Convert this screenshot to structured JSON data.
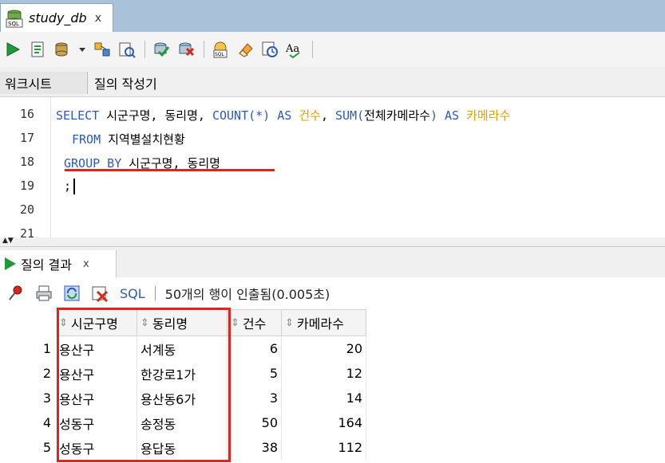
{
  "document_tab": {
    "title": "study_db",
    "close": "x"
  },
  "subtabs": {
    "worksheet": "워크시트",
    "query_builder": "질의 작성기"
  },
  "editor": {
    "line_numbers": [
      "16",
      "17",
      "18",
      "19",
      "20",
      "21"
    ],
    "line16": {
      "select": "SELECT",
      "col1": " 시군구명, 동리명, ",
      "count": "COUNT(*)",
      "as1": " AS ",
      "alias1": "건수",
      "comma": ", ",
      "sum": "SUM(",
      "sumarg": "전체카메라수",
      "sumclose": ")",
      "as2": " AS ",
      "alias2": "카메라수"
    },
    "line17": {
      "from": "FROM",
      "table": " 지역별설치현황"
    },
    "line18": {
      "groupby": "GROUP BY",
      "cols": " 시군구명, 동리명"
    },
    "line19": {
      "semicolon": ";"
    }
  },
  "results_tab": {
    "label": "질의 결과",
    "close": "x"
  },
  "results_toolbar": {
    "sql": "SQL",
    "status": "50개의 행이 인출됨(0.005초)"
  },
  "grid": {
    "columns": [
      "시군구명",
      "동리명",
      "건수",
      "카메라수"
    ],
    "rows": [
      {
        "num": "1",
        "sigungu": "용산구",
        "dongri": "서계동",
        "count": "6",
        "cameras": "20"
      },
      {
        "num": "2",
        "sigungu": "용산구",
        "dongri": "한강로1가",
        "count": "5",
        "cameras": "12"
      },
      {
        "num": "3",
        "sigungu": "용산구",
        "dongri": "용산동6가",
        "count": "3",
        "cameras": "14"
      },
      {
        "num": "4",
        "sigungu": "성동구",
        "dongri": "송정동",
        "count": "50",
        "cameras": "164"
      },
      {
        "num": "5",
        "sigungu": "성동구",
        "dongri": "용답동",
        "count": "38",
        "cameras": "112"
      }
    ]
  },
  "colors": {
    "keyword": "#2c59c0",
    "alias": "#e0a000",
    "annotation": "#e0241b"
  }
}
